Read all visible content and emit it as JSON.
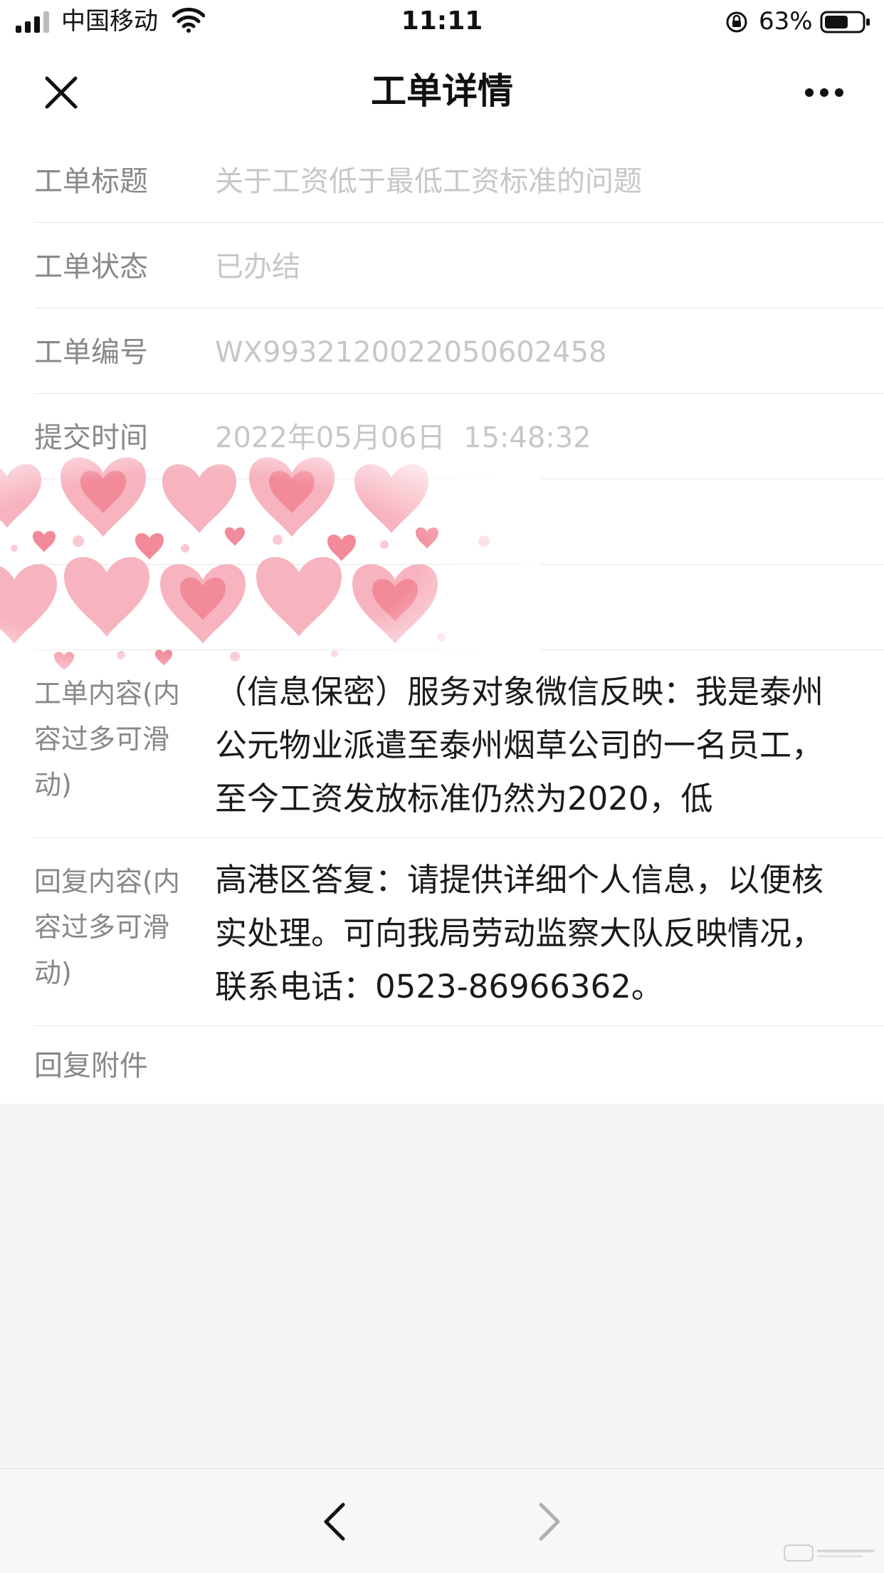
{
  "status_bar": {
    "carrier": "中国移动",
    "time": "11:11",
    "battery_percent": "63%",
    "battery_level": 0.63,
    "icons": [
      "signal-icon",
      "wifi-icon",
      "rotation-lock-icon",
      "battery-icon"
    ]
  },
  "nav": {
    "title": "工单详情",
    "close_icon": "close-icon",
    "more_icon": "more-icon"
  },
  "fields": {
    "title_label": "工单标题",
    "title_value": "关于工资低于最低工资标准的问题",
    "status_label": "工单状态",
    "status_value": "已办结",
    "number_label": "工单编号",
    "number_value": "WX9932120022050602458",
    "time_label": "提交时间",
    "time_value": "2022年05月06日  15:48:32",
    "content_label": "工单内容(内容过多可滑动)",
    "content_value": "（信息保密）服务对象微信反映：我是泰州公元物业派遣至泰州烟草公司的一名员工，至今工资发放标准仍然为2020，低",
    "reply_label": "回复内容(内容过多可滑动)",
    "reply_value": "高港区答复：请提供详细个人信息，以便核实处理。可向我局劳动监察大队反映情况，联系电话：0523-86966362。",
    "attachment_label": "回复附件"
  },
  "bottom_bar": {
    "back_icon": "chevron-left-icon",
    "forward_icon": "chevron-right-icon"
  },
  "colors": {
    "label": "#888888",
    "value_light": "#c7c7c7",
    "value_dark": "#1a1a1a",
    "divider": "#e6e6e6",
    "page_bg": "#f4f4f4",
    "heart_pink": "#f7a8b4",
    "heart_deep": "#f28a99"
  }
}
